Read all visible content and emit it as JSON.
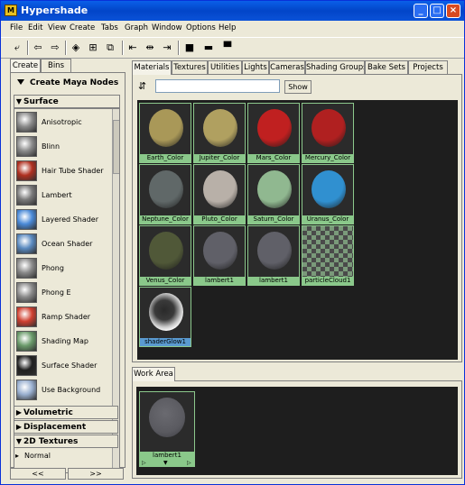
{
  "window": {
    "title": "Hypershade"
  },
  "menu": [
    "File",
    "Edit",
    "View",
    "Create",
    "Tabs",
    "Graph",
    "Window",
    "Options",
    "Help"
  ],
  "left_tabs": [
    "Create",
    "Bins"
  ],
  "create_header": "Create Maya Nodes",
  "sections": {
    "surface": "Surface",
    "volumetric": "Volumetric",
    "displacement": "Displacement",
    "textures2d": "2D Textures",
    "normal": "Normal"
  },
  "nodes": [
    {
      "label": "Anisotropic",
      "color": "#8a8a8a"
    },
    {
      "label": "Blinn",
      "color": "#8a8a8a"
    },
    {
      "label": "Hair Tube Shader",
      "color": "#b03020"
    },
    {
      "label": "Lambert",
      "color": "#7a7a7a"
    },
    {
      "label": "Layered Shader",
      "color": "#4a8ad8"
    },
    {
      "label": "Ocean Shader",
      "color": "#5a8ac0"
    },
    {
      "label": "Phong",
      "color": "#8a8a8a"
    },
    {
      "label": "Phong E",
      "color": "#8a8a8a"
    },
    {
      "label": "Ramp Shader",
      "color": "#d04030"
    },
    {
      "label": "Shading Map",
      "color": "#6a9a6a"
    },
    {
      "label": "Surface Shader",
      "color": "#202020"
    },
    {
      "label": "Use Background",
      "color": "#9ab0d0"
    }
  ],
  "left_footer": [
    "<<",
    ">>"
  ],
  "tabs": [
    "Materials",
    "Textures",
    "Utilities",
    "Lights",
    "Cameras",
    "Shading Groups",
    "Bake Sets",
    "Projects"
  ],
  "show_button": "Show",
  "search": {
    "value": ""
  },
  "swatches": [
    {
      "label": "Earth_Color",
      "color": "#a99858"
    },
    {
      "label": "Jupiter_Color",
      "color": "#b0a060"
    },
    {
      "label": "Mars_Color",
      "color": "#c02020"
    },
    {
      "label": "Mercury_Color",
      "color": "#b02020"
    },
    {
      "label": "Neptune_Color",
      "color": "#606868"
    },
    {
      "label": "Pluto_Color",
      "color": "#b8b0a8"
    },
    {
      "label": "Saturn_Color",
      "color": "#90b890"
    },
    {
      "label": "Uranus_Color",
      "color": "#3090d0"
    },
    {
      "label": "Venus_Color",
      "color": "#505838"
    },
    {
      "label": "lambert1",
      "color": "#606068"
    },
    {
      "label": "lambert1",
      "color": "#606068"
    },
    {
      "label": "particleCloud1",
      "color": "checker"
    },
    {
      "label": "shaderGlow1",
      "color": "glow"
    }
  ],
  "workarea": {
    "tab": "Work Area",
    "node_label": "lambert1"
  }
}
